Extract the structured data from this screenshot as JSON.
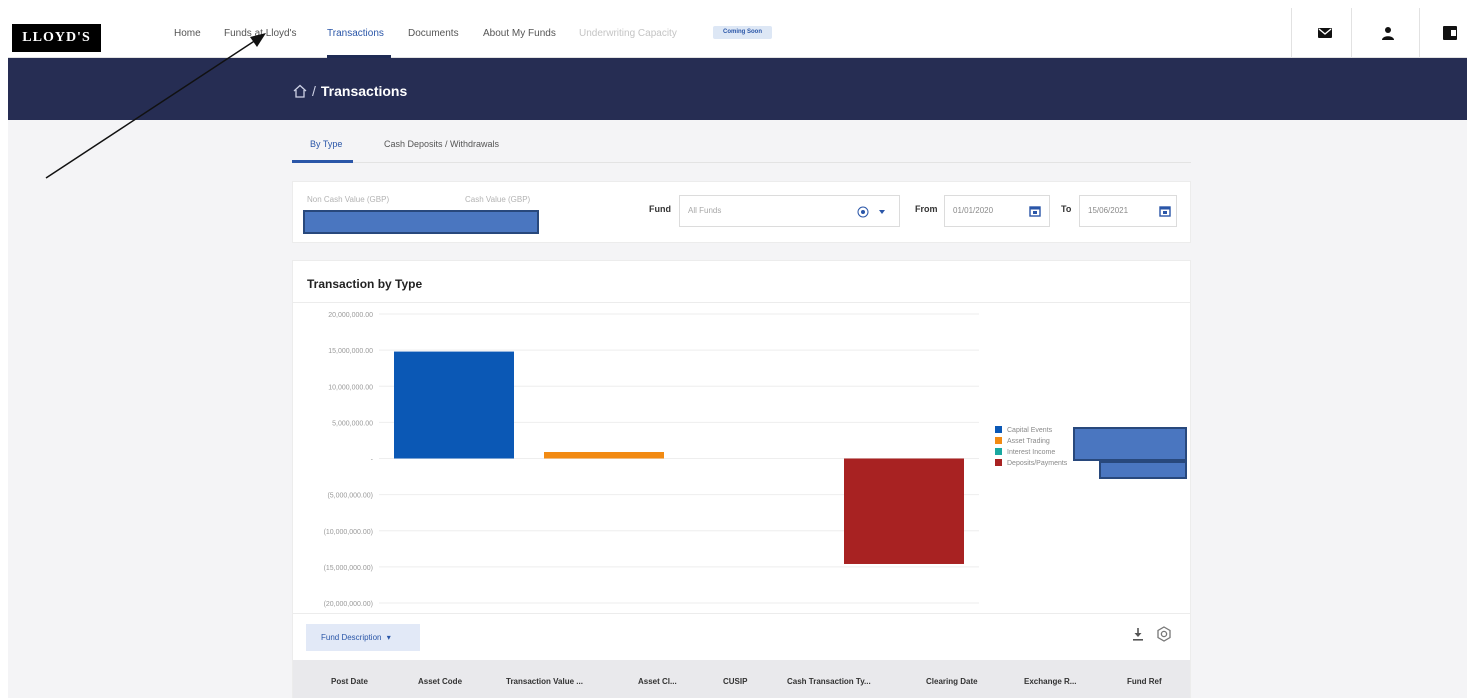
{
  "brand": {
    "logo_text": "LLOYD'S"
  },
  "nav": {
    "items": [
      {
        "label": "Home",
        "state": "normal"
      },
      {
        "label": "Funds at Lloyd's",
        "state": "normal"
      },
      {
        "label": "Transactions",
        "state": "active"
      },
      {
        "label": "Documents",
        "state": "normal"
      },
      {
        "label": "About My Funds",
        "state": "normal"
      },
      {
        "label": "Underwriting Capacity",
        "state": "disabled"
      }
    ],
    "badge": "Coming Soon",
    "icons": [
      "mail-icon",
      "user-icon",
      "logout-icon"
    ]
  },
  "header": {
    "breadcrumb_separator": "/",
    "title": "Transactions"
  },
  "tabs": [
    {
      "label": "By Type",
      "active": true
    },
    {
      "label": "Cash Deposits / Withdrawals",
      "active": false
    }
  ],
  "filters": {
    "non_cash_label": "Non Cash Value (GBP)",
    "cash_label": "Cash Value (GBP)",
    "fund_label": "Fund",
    "fund_placeholder": "All Funds",
    "from_label": "From",
    "from_value": "01/01/2020",
    "to_label": "To",
    "to_value": "15/06/2021"
  },
  "chart_card": {
    "title": "Transaction by Type"
  },
  "chart_data": {
    "type": "bar",
    "title": "Transaction by Type",
    "categories": [
      "Capital Events",
      "Asset Trading",
      "Interest Income",
      "Deposits/Payments"
    ],
    "values": [
      14800000,
      900000,
      0,
      -14600000
    ],
    "colors": [
      "#0b58b5",
      "#f28a12",
      "#1aa8a0",
      "#a82222"
    ],
    "ylim": [
      -20000000,
      20000000
    ],
    "yticks": [
      20000000,
      15000000,
      10000000,
      5000000,
      0,
      -5000000,
      -10000000,
      -15000000,
      -20000000
    ],
    "ytick_labels": [
      "20,000,000.00",
      "15,000,000.00",
      "10,000,000.00",
      "5,000,000.00",
      "-",
      "(5,000,000.00)",
      "(10,000,000.00)",
      "(15,000,000.00)",
      "(20,000,000.00)"
    ],
    "legend_labels": [
      "Capital Events",
      "Asset Trading",
      "Interest Income",
      "Deposits/Payments"
    ],
    "legend_position": "right",
    "grid": true
  },
  "table": {
    "group_button": "Fund Description",
    "columns": [
      "Post Date",
      "Asset Code",
      "Transaction Value ...",
      "Asset Cl...",
      "CUSIP",
      "Cash Transaction Ty...",
      "Clearing Date",
      "Exchange R...",
      "Fund Ref"
    ]
  }
}
